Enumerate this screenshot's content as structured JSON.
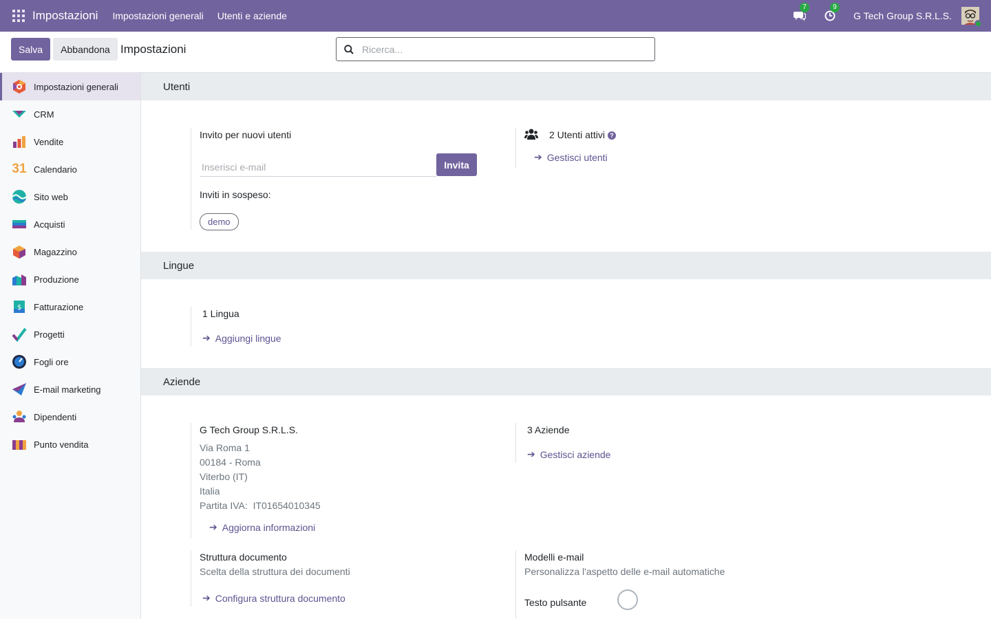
{
  "navbar": {
    "brand": "Impostazioni",
    "menus": [
      "Impostazioni generali",
      "Utenti e aziende"
    ],
    "messages_count": "7",
    "activities_count": "9",
    "company": "G Tech Group S.R.L.S."
  },
  "control_panel": {
    "save_label": "Salva",
    "discard_label": "Abbandona",
    "title": "Impostazioni",
    "search_placeholder": "Ricerca..."
  },
  "sidebar": {
    "items": [
      {
        "label": "Impostazioni generali",
        "icon": "settings-icon"
      },
      {
        "label": "CRM",
        "icon": "crm-icon"
      },
      {
        "label": "Vendite",
        "icon": "sales-icon"
      },
      {
        "label": "Calendario",
        "icon": "calendar-icon"
      },
      {
        "label": "Sito web",
        "icon": "website-icon"
      },
      {
        "label": "Acquisti",
        "icon": "purchase-icon"
      },
      {
        "label": "Magazzino",
        "icon": "inventory-icon"
      },
      {
        "label": "Produzione",
        "icon": "manufacturing-icon"
      },
      {
        "label": "Fatturazione",
        "icon": "invoicing-icon"
      },
      {
        "label": "Progetti",
        "icon": "project-icon"
      },
      {
        "label": "Fogli ore",
        "icon": "timesheet-icon"
      },
      {
        "label": "E-mail marketing",
        "icon": "email-marketing-icon"
      },
      {
        "label": "Dipendenti",
        "icon": "employees-icon"
      },
      {
        "label": "Punto vendita",
        "icon": "pos-icon"
      }
    ],
    "calendar_number": "31"
  },
  "users": {
    "section_title": "Utenti",
    "invite_label": "Invito per nuovi utenti",
    "email_placeholder": "Inserisci e-mail",
    "invite_button": "Invita",
    "pending_label": "Inviti in sospeso:",
    "pending_tag": "demo",
    "active_users": "2 Utenti attivi",
    "help_icon": "?",
    "manage_users": "Gestisci utenti"
  },
  "languages": {
    "section_title": "Lingue",
    "count": "1 Lingua",
    "add_link": "Aggiungi lingue"
  },
  "companies": {
    "section_title": "Aziende",
    "company_name": "G Tech Group S.R.L.S.",
    "address_street": "Via Roma 1",
    "address_city": "00184 - Roma",
    "address_province": "Viterbo (IT)",
    "address_country": "Italia",
    "vat_label": "Partita IVA:",
    "vat_value": "IT01654010345",
    "update_info": "Aggiorna informazioni",
    "companies_count": "3 Aziende",
    "manage_companies": "Gestisci aziende",
    "doc_layout_title": "Struttura documento",
    "doc_layout_desc": "Scelta della struttura dei documenti",
    "doc_layout_link": "Configura struttura documento",
    "email_templates_title": "Modelli e-mail",
    "email_templates_desc": "Personalizza l'aspetto delle e-mail automatiche",
    "button_text_label": "Testo pulsante"
  },
  "colors": {
    "primary": "#71639e",
    "link": "#5f5290",
    "success": "#28a745"
  }
}
